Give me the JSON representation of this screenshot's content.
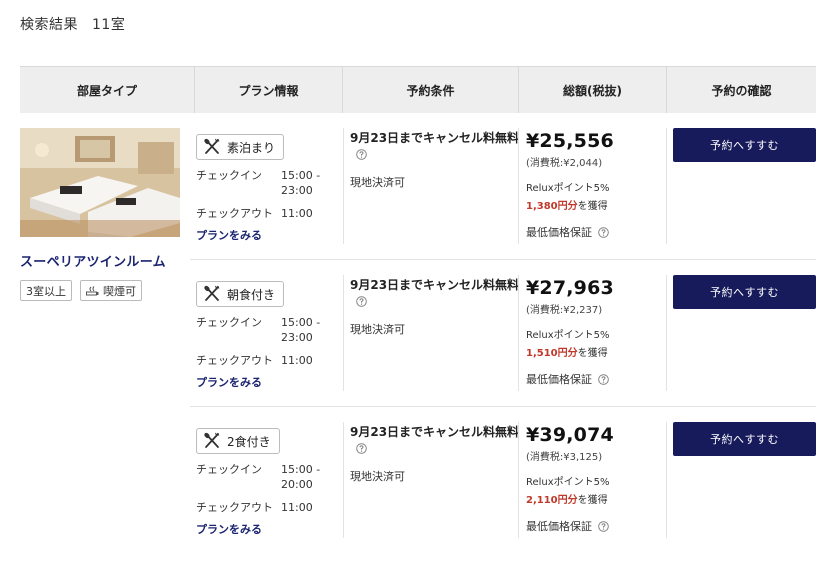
{
  "search": {
    "label": "検索結果",
    "count": "11室"
  },
  "table": {
    "headers": [
      "部屋タイプ",
      "プラン情報",
      "予約条件",
      "総額(税抜)",
      "予約の確認"
    ]
  },
  "room": {
    "name": "スーペリアツインルーム",
    "tags": [
      "3室以上",
      "喫煙可"
    ]
  },
  "plans": [
    {
      "name": "素泊まり",
      "checkin_label": "チェックイン",
      "checkin_time": "15:00 - 23:00",
      "checkout_label": "チェックアウト",
      "checkout_time": "11:00",
      "link": "プランをみる",
      "cancel": "9月23日までキャンセル料無料",
      "payment": "現地決済可",
      "price": "¥25,556",
      "tax": "(消費税:¥2,044)",
      "points": "Reluxポイント5%",
      "earn_amount": "1,380円分",
      "earn_suffix": "を獲得",
      "guarantee": "最低価格保証",
      "button": "予約へすすむ"
    },
    {
      "name": "朝食付き",
      "checkin_label": "チェックイン",
      "checkin_time": "15:00 - 23:00",
      "checkout_label": "チェックアウト",
      "checkout_time": "11:00",
      "link": "プランをみる",
      "cancel": "9月23日までキャンセル料無料",
      "payment": "現地決済可",
      "price": "¥27,963",
      "tax": "(消費税:¥2,237)",
      "points": "Reluxポイント5%",
      "earn_amount": "1,510円分",
      "earn_suffix": "を獲得",
      "guarantee": "最低価格保証",
      "button": "予約へすすむ"
    },
    {
      "name": "2食付き",
      "checkin_label": "チェックイン",
      "checkin_time": "15:00 - 20:00",
      "checkout_label": "チェックアウト",
      "checkout_time": "11:00",
      "link": "プランをみる",
      "cancel": "9月23日までキャンセル料無料",
      "payment": "現地決済可",
      "price": "¥39,074",
      "tax": "(消費税:¥3,125)",
      "points": "Reluxポイント5%",
      "earn_amount": "2,110円分",
      "earn_suffix": "を獲得",
      "guarantee": "最低価格保証",
      "button": "予約へすすむ"
    }
  ],
  "colors": {
    "navy": "#171b5c",
    "accent_red": "#c0392b",
    "header_bg": "#eeeeee"
  },
  "icons": [
    "meal-icon",
    "help-icon",
    "smoking-icon"
  ]
}
